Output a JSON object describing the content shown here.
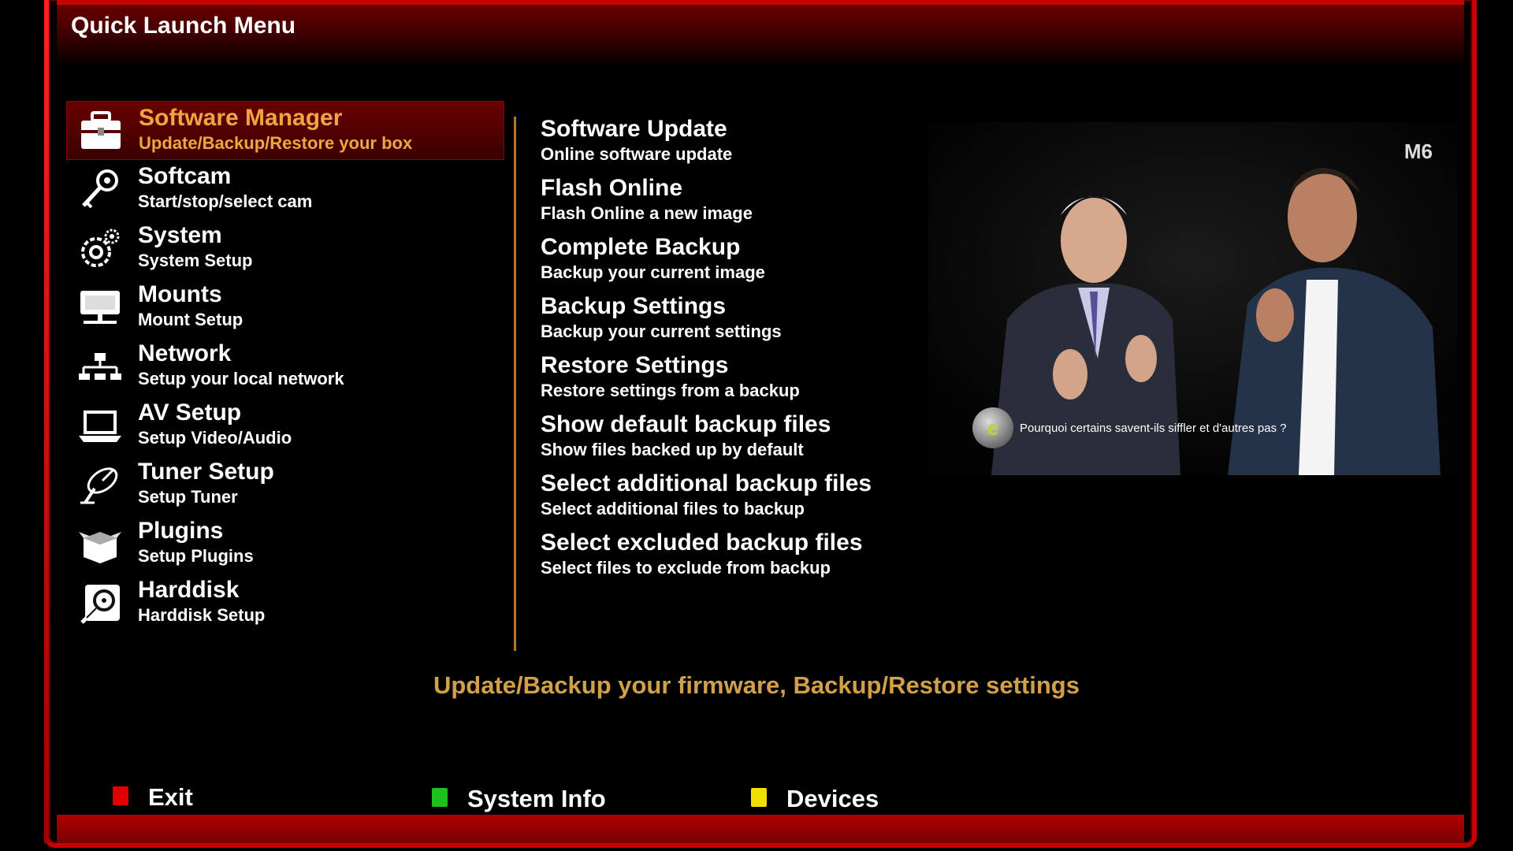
{
  "header": {
    "title": "Quick Launch Menu"
  },
  "menu": [
    {
      "title": "Software Manager",
      "subtitle": "Update/Backup/Restore your box",
      "icon": "briefcase-icon",
      "selected": true
    },
    {
      "title": "Softcam",
      "subtitle": "Start/stop/select cam",
      "icon": "key-icon",
      "selected": false
    },
    {
      "title": "System",
      "subtitle": "System Setup",
      "icon": "gear-icon",
      "selected": false
    },
    {
      "title": "Mounts",
      "subtitle": "Mount Setup",
      "icon": "network-drive-icon",
      "selected": false
    },
    {
      "title": "Network",
      "subtitle": "Setup your local network",
      "icon": "network-icon",
      "selected": false
    },
    {
      "title": "AV Setup",
      "subtitle": "Setup Video/Audio",
      "icon": "laptop-icon",
      "selected": false
    },
    {
      "title": "Tuner Setup",
      "subtitle": "Setup Tuner",
      "icon": "satellite-dish-icon",
      "selected": false
    },
    {
      "title": "Plugins",
      "subtitle": "Setup Plugins",
      "icon": "box-icon",
      "selected": false
    },
    {
      "title": "Harddisk",
      "subtitle": "Harddisk Setup",
      "icon": "harddisk-icon",
      "selected": false
    }
  ],
  "submenu": [
    {
      "title": "Software Update",
      "desc": "Online software update"
    },
    {
      "title": "Flash Online",
      "desc": "Flash Online a new image"
    },
    {
      "title": "Complete Backup",
      "desc": "Backup your current image"
    },
    {
      "title": "Backup Settings",
      "desc": "Backup your current settings"
    },
    {
      "title": "Restore Settings",
      "desc": "Restore settings from a backup"
    },
    {
      "title": "Show default backup files",
      "desc": "Show files backed up by default"
    },
    {
      "title": "Select additional backup files",
      "desc": "Select additional files to backup"
    },
    {
      "title": "Select excluded backup files",
      "desc": "Select files to exclude from backup"
    }
  ],
  "preview": {
    "channel_logo": "M6",
    "show_badge": "e",
    "caption": "Pourquoi certains savent-ils siffler et d'autres pas ?"
  },
  "description": "Update/Backup your firmware, Backup/Restore settings",
  "footer": [
    {
      "label": "Exit",
      "color": "#e00000"
    },
    {
      "label": "System Info",
      "color": "#1fbf1f"
    },
    {
      "label": "Devices",
      "color": "#f0e000"
    }
  ],
  "colors": {
    "accent_red": "#c70000",
    "highlight_text": "#f0a640",
    "description_text": "#d3a04a",
    "divider": "#b8751f"
  }
}
